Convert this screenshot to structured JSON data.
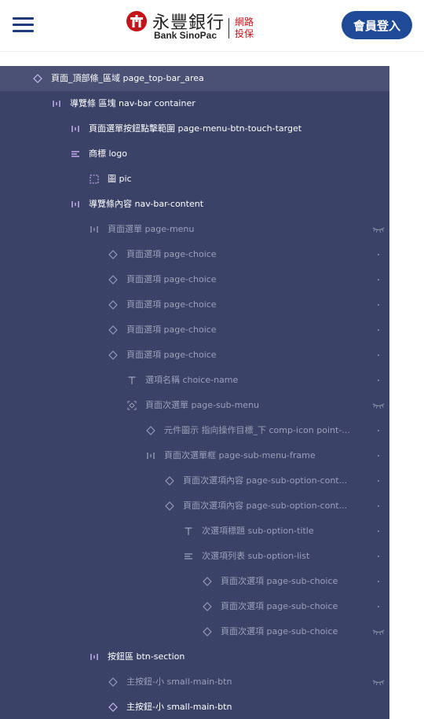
{
  "header": {
    "menu_icon": "hamburger-icon",
    "logo": {
      "chinese_name": "永豐銀行",
      "english_name": "Bank SinoPac",
      "tagline": "網路 投保",
      "brand_color": "#c4141b"
    },
    "login_label": "會員登入",
    "login_color": "#1f4a97"
  },
  "layers": [
    {
      "label": "頁面_頂部條_區域 page_top-bar_area",
      "icon": "component-diamond-icon",
      "state": "selected",
      "trail": "none"
    },
    {
      "label": "導覽條 區塊 nav-bar container",
      "icon": "horizontal-layout-icon",
      "state": "bright",
      "trail": "none"
    },
    {
      "label": "頁面選單按鈕點擊範圍 page-menu-btn-touch-target",
      "icon": "horizontal-layout-icon",
      "state": "bright",
      "trail": "none"
    },
    {
      "label": "商標 logo",
      "icon": "vertical-layout-icon",
      "state": "bright",
      "trail": "none"
    },
    {
      "label": "圖 pic",
      "icon": "frame-dashed-icon",
      "state": "bright",
      "trail": "none"
    },
    {
      "label": "導覽條內容 nav-bar-content",
      "icon": "horizontal-layout-icon",
      "state": "bright",
      "trail": "none"
    },
    {
      "label": "頁面選單 page-menu",
      "icon": "horizontal-layout-icon",
      "state": "dim",
      "trail": "hidden-eye-icon"
    },
    {
      "label": "頁面選項 page-choice",
      "icon": "component-diamond-icon",
      "state": "dim",
      "trail": "dot"
    },
    {
      "label": "頁面選項 page-choice",
      "icon": "component-diamond-icon",
      "state": "dim",
      "trail": "dot"
    },
    {
      "label": "頁面選項 page-choice",
      "icon": "component-diamond-icon",
      "state": "dim",
      "trail": "dot"
    },
    {
      "label": "頁面選項 page-choice",
      "icon": "component-diamond-icon",
      "state": "dim",
      "trail": "dot"
    },
    {
      "label": "頁面選項 page-choice",
      "icon": "component-diamond-icon",
      "state": "dim",
      "trail": "dot"
    },
    {
      "label": "選項名稱 choice-name",
      "icon": "text-icon",
      "state": "dim",
      "trail": "dot"
    },
    {
      "label": "頁面次選單 page-sub-menu",
      "icon": "component-instance-frame-icon",
      "state": "dim",
      "trail": "hidden-eye-icon"
    },
    {
      "label": "元件圖示 指向操作目標_下 comp-icon point-...",
      "icon": "component-diamond-icon",
      "state": "dim",
      "trail": "dot"
    },
    {
      "label": "頁面次選單框 page-sub-menu-frame",
      "icon": "horizontal-layout-icon",
      "state": "dim",
      "trail": "dot"
    },
    {
      "label": "頁面次選項內容 page-sub-option-cont...",
      "icon": "component-diamond-icon",
      "state": "dim",
      "trail": "dot"
    },
    {
      "label": "頁面次選項內容 page-sub-option-cont...",
      "icon": "component-diamond-icon",
      "state": "dim",
      "trail": "dot"
    },
    {
      "label": "次選項標題 sub-option-title",
      "icon": "text-icon",
      "state": "dim",
      "trail": "dot"
    },
    {
      "label": "次選項列表 sub-option-list",
      "icon": "vertical-layout-icon",
      "state": "dim",
      "trail": "dot"
    },
    {
      "label": "頁面次選項 page-sub-choice",
      "icon": "component-diamond-icon",
      "state": "dim",
      "trail": "dot"
    },
    {
      "label": "頁面次選項 page-sub-choice",
      "icon": "component-diamond-icon",
      "state": "dim",
      "trail": "dot"
    },
    {
      "label": "頁面次選項 page-sub-choice",
      "icon": "component-diamond-icon",
      "state": "dim",
      "trail": "hidden-eye-icon"
    },
    {
      "label": "按鈕區 btn-section",
      "icon": "horizontal-layout-icon",
      "state": "bright",
      "trail": "none"
    },
    {
      "label": "主按鈕-小 small-main-btn",
      "icon": "component-diamond-icon",
      "state": "dim",
      "trail": "hidden-eye-icon"
    },
    {
      "label": "主按鈕-小 small-main-btn",
      "icon": "component-diamond-icon",
      "state": "bright",
      "trail": "none"
    }
  ]
}
